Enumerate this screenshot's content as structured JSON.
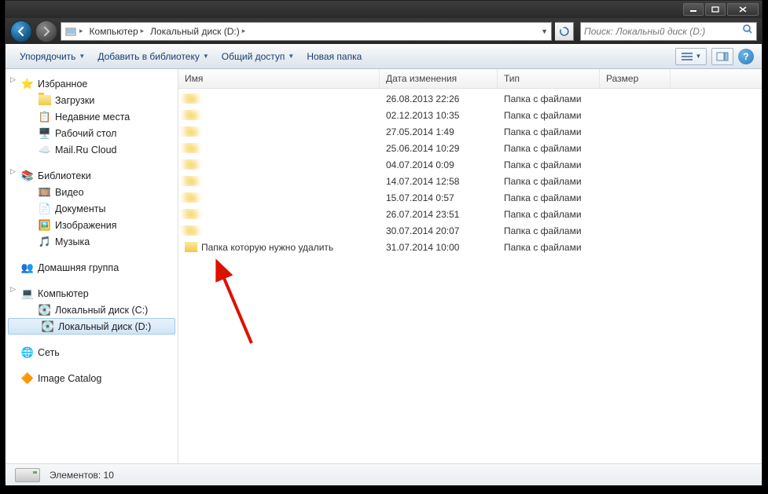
{
  "address": {
    "segments": [
      "Компьютер",
      "Локальный диск (D:)"
    ]
  },
  "search": {
    "placeholder": "Поиск: Локальный диск (D:)"
  },
  "toolbar": {
    "organize": "Упорядочить",
    "add_library": "Добавить в библиотеку",
    "share": "Общий доступ",
    "new_folder": "Новая папка"
  },
  "sidebar": {
    "favorites": "Избранное",
    "downloads": "Загрузки",
    "recent": "Недавние места",
    "desktop": "Рабочий стол",
    "mailru": "Mail.Ru Cloud",
    "libraries": "Библиотеки",
    "videos": "Видео",
    "documents": "Документы",
    "images": "Изображения",
    "music": "Музыка",
    "homegroup": "Домашняя группа",
    "computer": "Компьютер",
    "drive_c": "Локальный диск (C:)",
    "drive_d": "Локальный диск (D:)",
    "network": "Сеть",
    "image_catalog": "Image Catalog"
  },
  "columns": {
    "name": "Имя",
    "date": "Дата изменения",
    "type": "Тип",
    "size": "Размер"
  },
  "files": [
    {
      "name": " ",
      "date": "26.08.2013 22:26",
      "type": "Папка с файлами",
      "blurred": true
    },
    {
      "name": " ",
      "date": "02.12.2013 10:35",
      "type": "Папка с файлами",
      "blurred": true
    },
    {
      "name": " ",
      "date": "27.05.2014 1:49",
      "type": "Папка с файлами",
      "blurred": true
    },
    {
      "name": " ",
      "date": "25.06.2014 10:29",
      "type": "Папка с файлами",
      "blurred": true
    },
    {
      "name": " ",
      "date": "04.07.2014 0:09",
      "type": "Папка с файлами",
      "blurred": true
    },
    {
      "name": " ",
      "date": "14.07.2014 12:58",
      "type": "Папка с файлами",
      "blurred": true
    },
    {
      "name": " ",
      "date": "15.07.2014 0:57",
      "type": "Папка с файлами",
      "blurred": true
    },
    {
      "name": " ",
      "date": "26.07.2014 23:51",
      "type": "Папка с файлами",
      "blurred": true
    },
    {
      "name": " ",
      "date": "30.07.2014 20:07",
      "type": "Папка с файлами",
      "blurred": true
    },
    {
      "name": "Папка которую нужно удалить",
      "date": "31.07.2014 10:00",
      "type": "Папка с файлами",
      "blurred": false
    }
  ],
  "status": {
    "count_label": "Элементов: 10"
  }
}
